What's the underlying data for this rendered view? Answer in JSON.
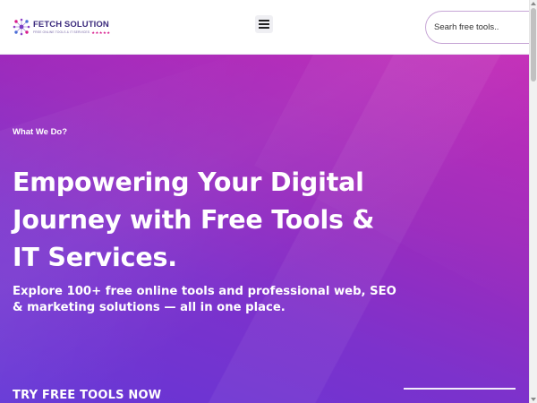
{
  "header": {
    "logo": {
      "name": "FETCH SOLUTION",
      "tagline": "FREE ONLINE TOOLS & IT SERVICES",
      "stars": "★★★★★",
      "icon": "network-nodes-icon"
    },
    "menu_icon": "hamburger-icon",
    "search": {
      "placeholder": "Searh free tools..",
      "value": ""
    }
  },
  "hero": {
    "eyebrow": "What We Do?",
    "headline": "Empowering Your Digital Journey with Free Tools & IT Services.",
    "subhead": "Explore 100+ free online tools and professional web, SEO & marketing solutions — all in one place.",
    "cta_label": "TRY FREE TOOLS NOW"
  },
  "colors": {
    "brand_primary": "#3b2a7c",
    "brand_accent": "#d81b8c",
    "hero_gradient_start": "#c021b3",
    "hero_gradient_end": "#6436d6"
  }
}
